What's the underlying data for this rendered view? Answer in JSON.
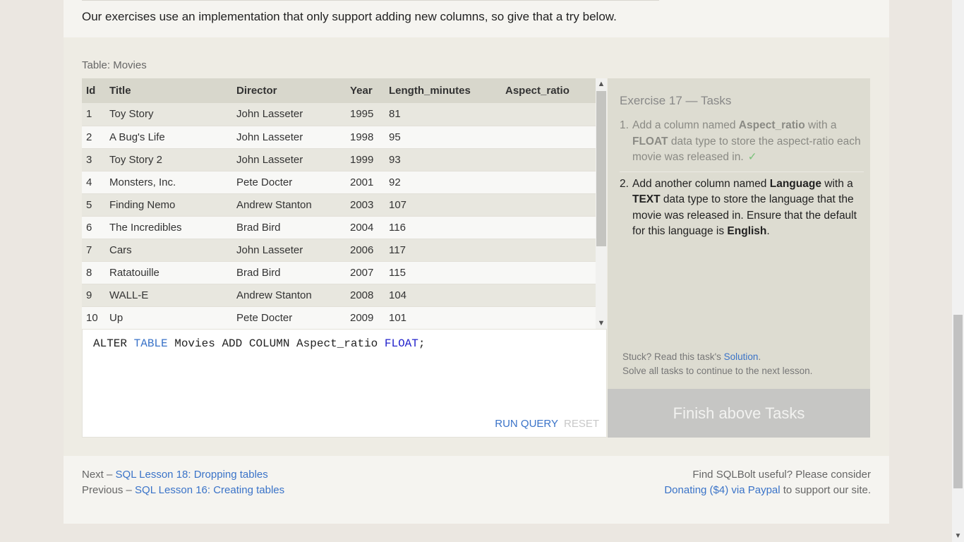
{
  "intro_text": "Our exercises use an implementation that only support adding new columns, so give that a try below.",
  "table_label": "Table: Movies",
  "table": {
    "columns": [
      "Id",
      "Title",
      "Director",
      "Year",
      "Length_minutes",
      "Aspect_ratio"
    ],
    "rows": [
      [
        "1",
        "Toy Story",
        "John Lasseter",
        "1995",
        "81",
        ""
      ],
      [
        "2",
        "A Bug's Life",
        "John Lasseter",
        "1998",
        "95",
        ""
      ],
      [
        "3",
        "Toy Story 2",
        "John Lasseter",
        "1999",
        "93",
        ""
      ],
      [
        "4",
        "Monsters, Inc.",
        "Pete Docter",
        "2001",
        "92",
        ""
      ],
      [
        "5",
        "Finding Nemo",
        "Andrew Stanton",
        "2003",
        "107",
        ""
      ],
      [
        "6",
        "The Incredibles",
        "Brad Bird",
        "2004",
        "116",
        ""
      ],
      [
        "7",
        "Cars",
        "John Lasseter",
        "2006",
        "117",
        ""
      ],
      [
        "8",
        "Ratatouille",
        "Brad Bird",
        "2007",
        "115",
        ""
      ],
      [
        "9",
        "WALL-E",
        "Andrew Stanton",
        "2008",
        "104",
        ""
      ],
      [
        "10",
        "Up",
        "Pete Docter",
        "2009",
        "101",
        ""
      ]
    ]
  },
  "editor": {
    "tokens": [
      "ALTER ",
      "TABLE",
      " Movies ADD COLUMN Aspect_ratio ",
      "FLOAT",
      ";"
    ],
    "run_label": "RUN QUERY",
    "reset_label": "RESET"
  },
  "tasks": {
    "title": "Exercise 17 — Tasks",
    "items": [
      {
        "num": "1.",
        "parts": [
          "Add a column named ",
          "Aspect_ratio",
          " with a ",
          "FLOAT",
          " data type to store the aspect-ratio each movie was released in."
        ],
        "check": "✓"
      },
      {
        "num": "2.",
        "parts": [
          "Add another column named ",
          "Language",
          " with a ",
          "TEXT",
          " data type to store the language that the movie was released in. Ensure that the default for this language is ",
          "English",
          "."
        ]
      }
    ],
    "stuck_prefix": "Stuck? Read this task's ",
    "stuck_link": "Solution",
    "stuck_suffix": ".",
    "solve_text": "Solve all tasks to continue to the next lesson.",
    "finish_label": "Finish above Tasks"
  },
  "footer": {
    "next_prefix": "Next – ",
    "next_link": "SQL Lesson 18: Dropping tables",
    "prev_prefix": "Previous – ",
    "prev_link": "SQL Lesson 16: Creating tables",
    "useful_text": "Find SQLBolt useful? Please consider",
    "donate_link": "Donating ($4) via Paypal",
    "donate_suffix": " to support our site."
  }
}
